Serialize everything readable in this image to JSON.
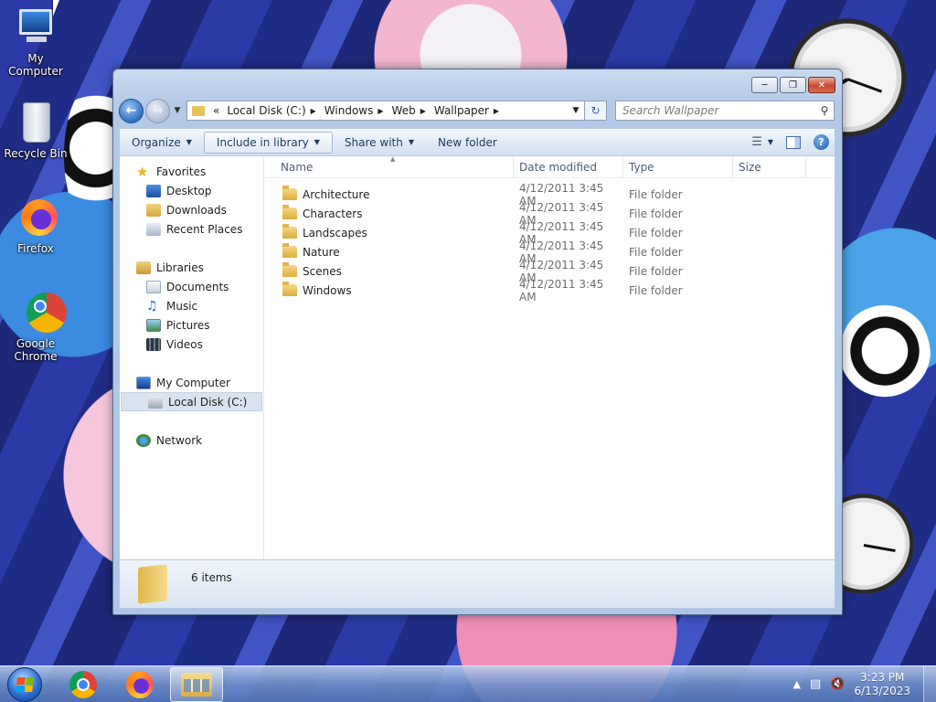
{
  "desktop": {
    "icons": [
      {
        "label": "My Computer",
        "icon": "computer-icon"
      },
      {
        "label": "Recycle Bin",
        "icon": "recycle-bin-icon"
      },
      {
        "label": "Firefox",
        "icon": "firefox-icon"
      },
      {
        "label": "Google Chrome",
        "icon": "chrome-icon"
      }
    ]
  },
  "window": {
    "address": {
      "overflow": "«",
      "segments": [
        "Local Disk (C:)",
        "Windows",
        "Web",
        "Wallpaper"
      ]
    },
    "search": {
      "placeholder": "Search Wallpaper"
    },
    "toolbar": {
      "organize": "Organize",
      "include_in_library": "Include in library",
      "share_with": "Share with",
      "new_folder": "New folder"
    },
    "nav": {
      "favorites": {
        "label": "Favorites",
        "items": [
          "Desktop",
          "Downloads",
          "Recent Places"
        ]
      },
      "libraries": {
        "label": "Libraries",
        "items": [
          "Documents",
          "Music",
          "Pictures",
          "Videos"
        ]
      },
      "computer": {
        "label": "My Computer",
        "items": [
          "Local Disk (C:)"
        ]
      },
      "network": {
        "label": "Network"
      }
    },
    "columns": [
      "Name",
      "Date modified",
      "Type",
      "Size"
    ],
    "files": [
      {
        "name": "Architecture",
        "date": "4/12/2011 3:45 AM",
        "type": "File folder"
      },
      {
        "name": "Characters",
        "date": "4/12/2011 3:45 AM",
        "type": "File folder"
      },
      {
        "name": "Landscapes",
        "date": "4/12/2011 3:45 AM",
        "type": "File folder"
      },
      {
        "name": "Nature",
        "date": "4/12/2011 3:45 AM",
        "type": "File folder"
      },
      {
        "name": "Scenes",
        "date": "4/12/2011 3:45 AM",
        "type": "File folder"
      },
      {
        "name": "Windows",
        "date": "4/12/2011 3:45 AM",
        "type": "File folder"
      }
    ],
    "details": {
      "item_count": "6 items"
    }
  },
  "taskbar": {
    "apps": [
      "chrome-icon",
      "firefox-icon",
      "windows-explorer-icon"
    ],
    "time": "3:23 PM",
    "date": "6/13/2023"
  },
  "colors": {
    "selection": "#d9e3ef",
    "folder": "#dcae3e",
    "accent": "#2f6fc4"
  }
}
